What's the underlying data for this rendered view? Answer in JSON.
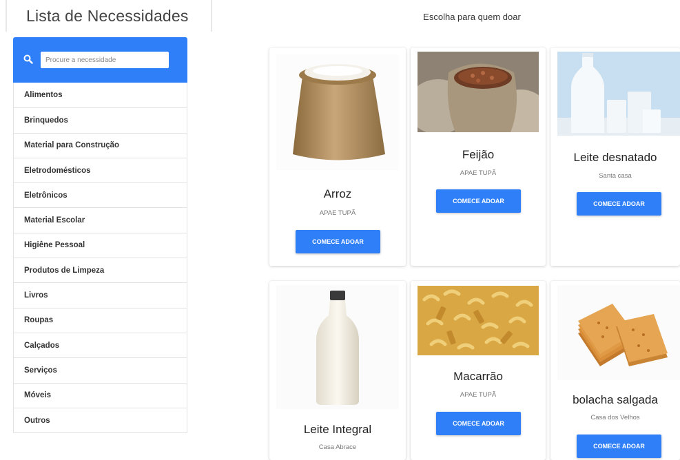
{
  "sidebar": {
    "title": "Lista de Necessidades",
    "search_placeholder": "Procure a necessidade",
    "categories": [
      "Alimentos",
      "Brinquedos",
      "Material para Construção",
      "Eletrodomésticos",
      "Eletrônicos",
      "Material Escolar",
      "Higiêne Pessoal",
      "Produtos de Limpeza",
      "Livros",
      "Roupas",
      "Calçados",
      "Serviços",
      "Móveis",
      "Outros"
    ]
  },
  "main": {
    "heading": "Escolha para quem doar",
    "button_label": "COMECE ADOAR",
    "cards": [
      {
        "name": "Arroz",
        "org": "APAE TUPÃ"
      },
      {
        "name": "Feijão",
        "org": "APAE TUPÃ"
      },
      {
        "name": "Leite desnatado",
        "org": "Santa casa"
      },
      {
        "name": "Leite Integral",
        "org": "Casa Abrace"
      },
      {
        "name": "Macarrão",
        "org": "APAE TUPÃ"
      },
      {
        "name": "bolacha salgada",
        "org": "Casa dos Velhos"
      }
    ]
  },
  "colors": {
    "accent": "#2f80f8"
  }
}
